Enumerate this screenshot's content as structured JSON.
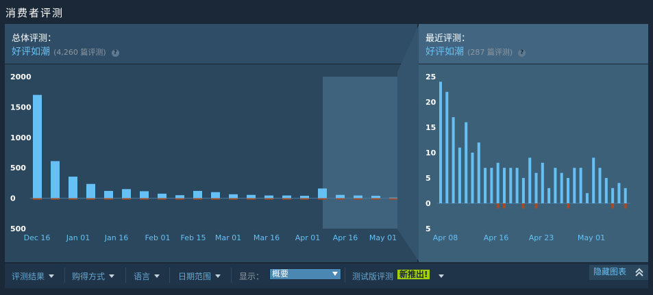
{
  "title": "消费者评测",
  "overall": {
    "label": "总体评测：",
    "summary": "好评如潮",
    "count": "(4,260 篇评测)"
  },
  "recent": {
    "label": "最近评测：",
    "summary": "好评如潮",
    "count": "(287 篇评测)"
  },
  "filters": {
    "result": "评测结果",
    "purchase": "购得方式",
    "language": "语言",
    "date_range": "日期范围",
    "display_label": "显示：",
    "display_value": "概要",
    "beta": "测试版评测",
    "beta_badge": "新推出!",
    "hide_graph": "隐藏图表"
  },
  "colors": {
    "positive": "#66c0f4",
    "negative": "#a34c25",
    "panel": "#2a475e",
    "recent_panel": "#3d6079"
  },
  "chart_data": [
    {
      "type": "bar",
      "title": "总体评测",
      "y_ticks": [
        "2000",
        "1500",
        "1000",
        "500",
        "0",
        "500"
      ],
      "ylim": [
        -500,
        2000
      ],
      "x_tick_labels": [
        "Dec 16",
        "Jan 01",
        "Jan 16",
        "Feb 01",
        "Feb 15",
        "Mar 01",
        "Mar 16",
        "Apr 01",
        "Apr 16",
        "May 01"
      ],
      "series": [
        {
          "values": [
            1700,
            610,
            355,
            235,
            120,
            150,
            115,
            75,
            50,
            120,
            100,
            65,
            55,
            45,
            45,
            40,
            160,
            55,
            45,
            40,
            10
          ]
        },
        {
          "values": [
            -25,
            -10,
            -5,
            -5,
            -3,
            -3,
            -2,
            -2,
            -2,
            -3,
            -2,
            -2,
            -2,
            -1,
            -1,
            -1,
            -4,
            -2,
            -1,
            -1,
            -1
          ]
        }
      ],
      "highlight": "recent period (Apr 04 – May 04)"
    },
    {
      "type": "bar",
      "title": "最近评测",
      "y_ticks": [
        "25",
        "20",
        "15",
        "10",
        "5",
        "0",
        "5"
      ],
      "ylim": [
        -5,
        25
      ],
      "x_tick_labels": [
        "Apr 08",
        "Apr 16",
        "Apr 23",
        "May 01"
      ],
      "series": [
        {
          "values": [
            24,
            22,
            17,
            11,
            16,
            10,
            12,
            7,
            7,
            8,
            7,
            7,
            7,
            5,
            9,
            6,
            8,
            3,
            7,
            6,
            5,
            7,
            7,
            2,
            9,
            7,
            5,
            3,
            4,
            3
          ]
        },
        {
          "values": [
            0,
            0,
            0,
            0,
            0,
            0,
            0,
            0,
            0,
            -1,
            -1,
            0,
            0,
            -1,
            0,
            -1,
            0,
            0,
            0,
            0,
            -1,
            0,
            0,
            0,
            0,
            0,
            0,
            -1,
            0,
            -1
          ]
        }
      ]
    }
  ]
}
